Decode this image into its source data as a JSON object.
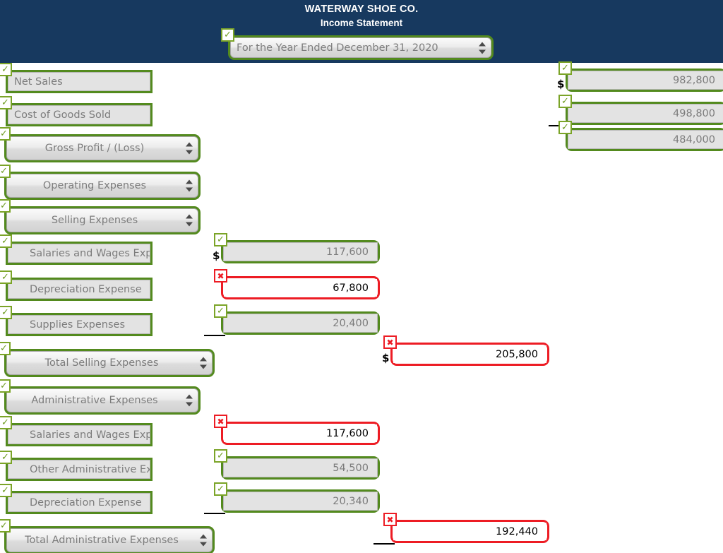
{
  "header": {
    "company": "WATERWAY SHOE CO.",
    "statement": "Income Statement",
    "period_select": {
      "value": "For the Year Ended December 31, 2020",
      "status": "correct",
      "icon": "checkmark-icon"
    }
  },
  "icons": {
    "correct": "✓",
    "incorrect": "✖"
  },
  "colors": {
    "header_bg": "#17395f",
    "correct_border": "#538a1e",
    "incorrect_border": "#ed1c24",
    "field_bg": "#e3e3e3",
    "field_text": "#7c7c7c",
    "error_text": "#000000"
  },
  "symbols": {
    "dollar": "$"
  },
  "rows": [
    {
      "id": "net-sales",
      "label": "Net Sales",
      "label_kind": "input",
      "label_status": "correct",
      "value": "982,800",
      "value_status": "correct",
      "value_column": "right",
      "dollar": true,
      "underline": false
    },
    {
      "id": "cost-of-goods-sold",
      "label": "Cost of Goods Sold",
      "label_kind": "input",
      "label_status": "correct",
      "value": "498,800",
      "value_status": "correct",
      "value_column": "right",
      "dollar": false,
      "underline": true
    },
    {
      "id": "gross-profit-loss",
      "label": "Gross Profit / (Loss)",
      "label_kind": "select",
      "label_status": "correct",
      "value": "484,000",
      "value_status": "correct",
      "value_column": "right",
      "dollar": false,
      "underline": false
    },
    {
      "id": "operating-expenses",
      "label": "Operating Expenses",
      "label_kind": "select",
      "label_status": "correct",
      "value": null,
      "value_status": null,
      "value_column": null,
      "dollar": false,
      "underline": false
    },
    {
      "id": "selling-expenses",
      "label": "Selling Expenses",
      "label_kind": "select",
      "label_status": "correct",
      "value": null,
      "value_status": null,
      "value_column": null,
      "dollar": false,
      "underline": false
    },
    {
      "id": "selling-salaries-and-wages-expense",
      "label": "Salaries and Wages Expense",
      "label_kind": "input",
      "label_status": "correct",
      "value": "117,600",
      "value_status": "correct",
      "value_column": "middle",
      "dollar": true,
      "underline": false
    },
    {
      "id": "selling-depreciation-expense",
      "label": "Depreciation Expense",
      "label_kind": "input",
      "label_status": "correct",
      "value": "67,800",
      "value_status": "incorrect",
      "value_column": "middle",
      "dollar": false,
      "underline": false
    },
    {
      "id": "selling-supplies-expenses",
      "label": "Supplies Expenses",
      "label_kind": "input",
      "label_status": "correct",
      "value": "20,400",
      "value_status": "correct",
      "value_column": "middle",
      "dollar": false,
      "underline": true
    },
    {
      "id": "total-selling-expenses",
      "label": "Total Selling Expenses",
      "label_kind": "select",
      "label_status": "correct",
      "value": "205,800",
      "value_status": "incorrect",
      "value_column": "far",
      "dollar": true,
      "underline": false
    },
    {
      "id": "administrative-expenses",
      "label": "Administrative Expenses",
      "label_kind": "select",
      "label_status": "correct",
      "value": null,
      "value_status": null,
      "value_column": null,
      "dollar": false,
      "underline": false
    },
    {
      "id": "admin-salaries-and-wages-expense",
      "label": "Salaries and Wages Expense",
      "label_kind": "input",
      "label_status": "correct",
      "value": "117,600",
      "value_status": "incorrect",
      "value_column": "middle",
      "dollar": false,
      "underline": false
    },
    {
      "id": "other-administrative-expenses",
      "label": "Other Administrative Expenses",
      "label_kind": "input",
      "label_status": "correct",
      "value": "54,500",
      "value_status": "correct",
      "value_column": "middle",
      "dollar": false,
      "underline": false
    },
    {
      "id": "admin-depreciation-expense",
      "label": "Depreciation Expense",
      "label_kind": "input",
      "label_status": "correct",
      "value": "20,340",
      "value_status": "correct",
      "value_column": "middle",
      "dollar": false,
      "underline": true
    },
    {
      "id": "total-administrative-expenses",
      "label": "Total Administrative Expenses",
      "label_kind": "select",
      "label_status": "correct",
      "value": "192,440",
      "value_status": "incorrect",
      "value_column": "far",
      "dollar": false,
      "underline": true
    }
  ]
}
